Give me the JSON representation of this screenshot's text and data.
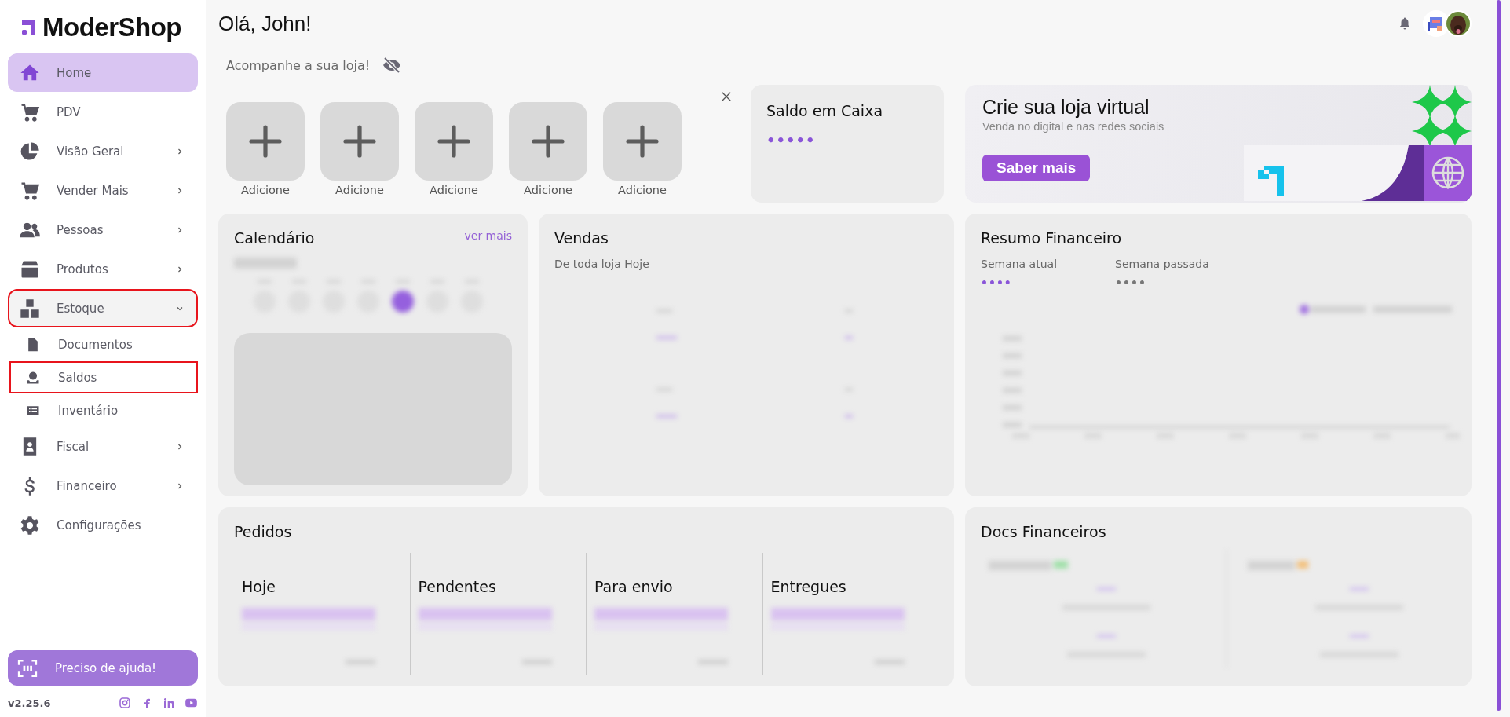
{
  "sidebar": {
    "logo": "ModerShop",
    "items": [
      {
        "label": "Home",
        "kind": "link",
        "selected": true,
        "highlighted": false
      },
      {
        "label": "PDV",
        "kind": "link",
        "selected": false,
        "highlighted": false
      },
      {
        "label": "Visão Geral",
        "kind": "group",
        "expanded": false,
        "selected": false,
        "highlighted": false
      },
      {
        "label": "Vender Mais",
        "kind": "group",
        "expanded": false,
        "selected": false,
        "highlighted": false
      },
      {
        "label": "Pessoas",
        "kind": "group",
        "expanded": false,
        "selected": false,
        "highlighted": false
      },
      {
        "label": "Produtos",
        "kind": "group",
        "expanded": false,
        "selected": false,
        "highlighted": false
      },
      {
        "label": "Estoque",
        "kind": "group",
        "expanded": true,
        "selected": false,
        "highlighted": true,
        "children": [
          {
            "label": "Documentos",
            "selected": false,
            "highlighted": false
          },
          {
            "label": "Saldos",
            "selected": false,
            "highlighted": true
          },
          {
            "label": "Inventário",
            "selected": false,
            "highlighted": false
          }
        ]
      },
      {
        "label": "Fiscal",
        "kind": "group",
        "expanded": false,
        "selected": false,
        "highlighted": false
      },
      {
        "label": "Financeiro",
        "kind": "group",
        "expanded": false,
        "selected": false,
        "highlighted": false
      },
      {
        "label": "Configurações",
        "kind": "link",
        "selected": false,
        "highlighted": false
      }
    ],
    "help_button": "Preciso de ajuda!",
    "version": "v2.25.6"
  },
  "header": {
    "greeting": "Olá, John!",
    "subtitle": "Acompanhe a sua loja!"
  },
  "shortcuts": [
    {
      "label": "Adicione"
    },
    {
      "label": "Adicione"
    },
    {
      "label": "Adicione"
    },
    {
      "label": "Adicione"
    },
    {
      "label": "Adicione"
    }
  ],
  "cash_card": {
    "title": "Saldo em Caixa",
    "value": "•••••"
  },
  "banner": {
    "title": "Crie sua loja virtual",
    "subtitle": "Venda no digital e nas redes sociais",
    "button": "Saber mais"
  },
  "calendar": {
    "title": "Calendário",
    "link": "ver mais"
  },
  "sales": {
    "title": "Vendas",
    "subtitle": "De toda loja Hoje"
  },
  "finance_summary": {
    "title": "Resumo Financeiro",
    "stats": [
      {
        "label": "Semana atual",
        "value": "••••",
        "kind": "current"
      },
      {
        "label": "Semana passada",
        "value": "••••",
        "kind": "previous"
      }
    ]
  },
  "orders": {
    "title": "Pedidos",
    "columns": [
      {
        "label": "Hoje"
      },
      {
        "label": "Pendentes"
      },
      {
        "label": "Para envio"
      },
      {
        "label": "Entregues"
      }
    ]
  },
  "finance_docs": {
    "title": "Docs Financeiros"
  }
}
